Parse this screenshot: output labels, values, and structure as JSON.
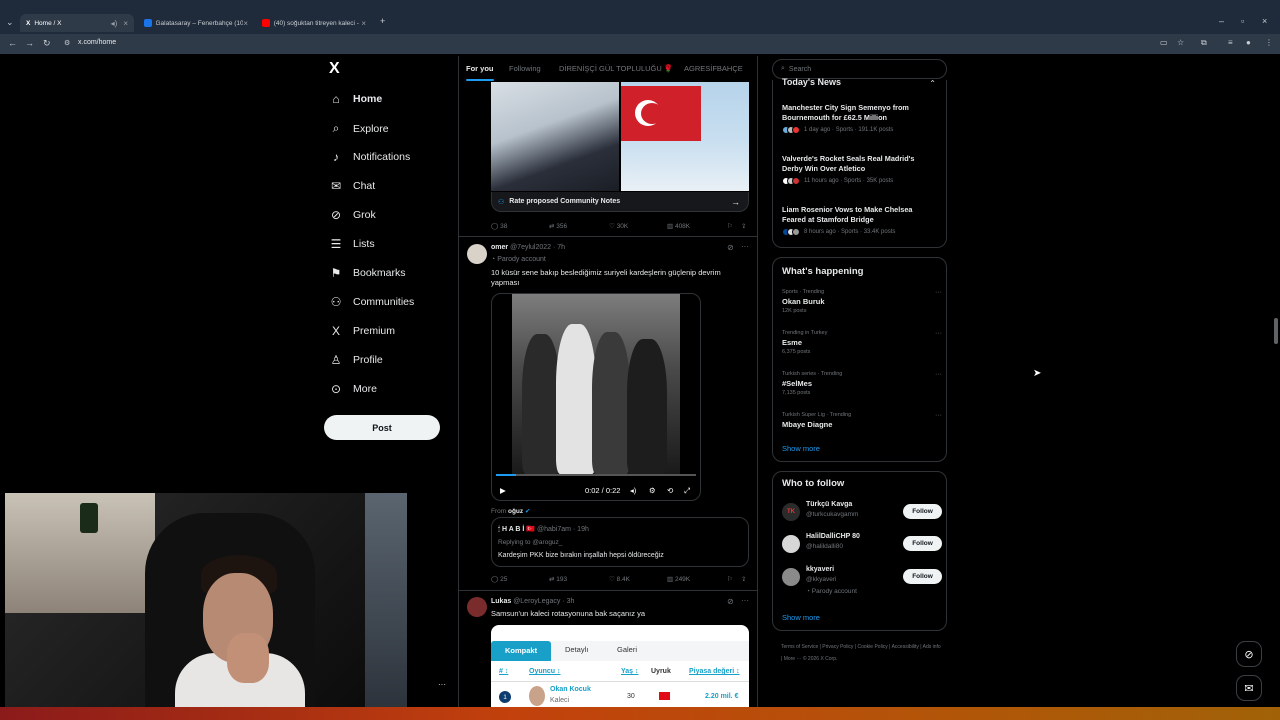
{
  "browser": {
    "tabs": [
      {
        "title": "Home / X",
        "fav_color": "#000000"
      },
      {
        "title": "Galatasaray – Fenerbahçe (10.0",
        "fav_color": "#1a73e8"
      },
      {
        "title": "(40) soğuktan titreyen kaleci - Y",
        "fav_color": "#ff0000"
      }
    ],
    "new_tab": "+",
    "url": "x.com/home"
  },
  "sidebar": {
    "logo": "X",
    "items": [
      {
        "label": "Home",
        "icon": "⌂"
      },
      {
        "label": "Explore",
        "icon": "⌕"
      },
      {
        "label": "Notifications",
        "icon": "♪"
      },
      {
        "label": "Chat",
        "icon": "✉"
      },
      {
        "label": "Grok",
        "icon": "⊘"
      },
      {
        "label": "Lists",
        "icon": "☰"
      },
      {
        "label": "Bookmarks",
        "icon": "⚑"
      },
      {
        "label": "Communities",
        "icon": "⚇"
      },
      {
        "label": "Premium",
        "icon": "X"
      },
      {
        "label": "Profile",
        "icon": "♙"
      },
      {
        "label": "More",
        "icon": "⊙"
      }
    ],
    "post_label": "Post"
  },
  "feed": {
    "tabs": [
      "For you",
      "Following",
      "DİRENİŞÇİ GÜL TOPLULUĞU 🌹",
      "AGRESİFBAHÇE"
    ],
    "post1": {
      "community_notes": "Rate proposed Community Notes",
      "replies": "38",
      "reposts": "356",
      "likes": "30K",
      "views": "408K"
    },
    "post2": {
      "name": "omer",
      "handle": "@7eylul2022 · 7h",
      "parody": "Parody account",
      "text": "10 küsür sene bakıp beslediğimiz suriyeli kardeşlerin güçlenip devrim yapması",
      "video_time": "0:02 / 0:22",
      "from_label": "From",
      "from_name": "oğuz",
      "quote_name": "H A B İ 🇹🇷",
      "quote_handle": "@habi7am · 19h",
      "quote_reply": "Replying to @aroguz_",
      "quote_text": "Kardeşim PKK bize bırakın inşallah hepsi  öldüreceğiz",
      "replies": "25",
      "reposts": "193",
      "likes": "8.4K",
      "views": "249K"
    },
    "post3": {
      "name": "Lukas",
      "handle": "@LeroyLegacy · 3h",
      "text": "Samsun'un kaleci rotasyonuna bak saçanız ya",
      "table_tabs": [
        "Kompakt",
        "Detaylı",
        "Galeri"
      ],
      "columns": [
        "# ↕",
        "Oyuncu ↕",
        "Yaş ↕",
        "Uyruk",
        "Piyasa değeri ↕"
      ],
      "row": {
        "rank": "1",
        "player": "Okan Kocuk",
        "position": "Kaleci",
        "age": "30",
        "value": "2.20 mil. €"
      }
    }
  },
  "right": {
    "search_placeholder": "Search",
    "news_title": "Today's News",
    "news": [
      {
        "title": "Manchester City Sign Semenyo from Bournemouth for £62.5 Million",
        "meta": "1 day ago · Sports · 191.1K posts"
      },
      {
        "title": "Valverde's Rocket Seals Real Madrid's Derby Win Over Atletico",
        "meta": "11 hours ago · Sports · 35K posts"
      },
      {
        "title": "Liam Rosenior Vows to Make Chelsea Feared at Stamford Bridge",
        "meta": "8 hours ago · Sports · 33.4K posts"
      }
    ],
    "happening_title": "What's happening",
    "trends": [
      {
        "cat": "Sports · Trending",
        "name": "Okan Buruk",
        "count": "12K posts"
      },
      {
        "cat": "Trending in Turkey",
        "name": "Esme",
        "count": "6,375 posts"
      },
      {
        "cat": "Turkish series · Trending",
        "name": "#SelMes",
        "count": "7,135 posts"
      },
      {
        "cat": "Turkish Super Lig · Trending",
        "name": "Mbaye Diagne",
        "count": ""
      }
    ],
    "show_more": "Show more",
    "wtf_title": "Who to follow",
    "wtf": [
      {
        "name": "Türkçü Kavga",
        "handle": "@turkcukavgamm",
        "parody": "",
        "follow": "Follow"
      },
      {
        "name": "HalilDalliCHP 80",
        "handle": "@halildalli80",
        "parody": "",
        "follow": "Follow"
      },
      {
        "name": "kkyaveri",
        "handle": "@kkyaveri",
        "parody": "Parody account",
        "follow": "Follow"
      }
    ],
    "show_more2": "Show more",
    "footer": "Terms of Service  |  Privacy Policy  |  Cookie Policy  |  Accessibility  |  Ads info  |  More ···  © 2026 X Corp."
  }
}
